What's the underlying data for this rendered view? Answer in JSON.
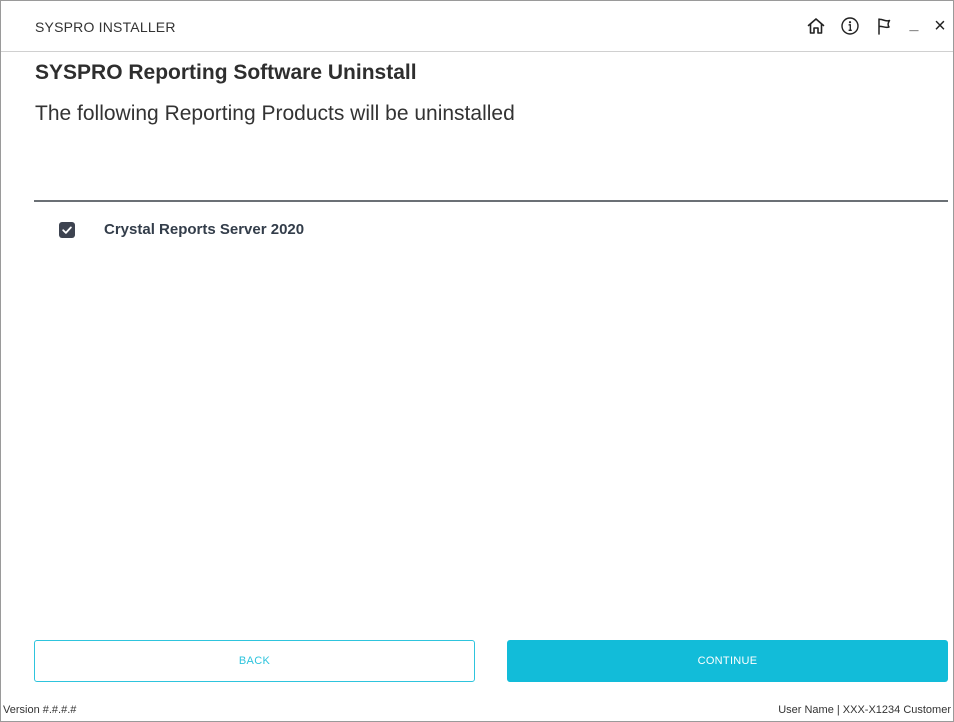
{
  "window": {
    "title": "SYSPRO INSTALLER",
    "controls": {
      "home_icon": "home-icon",
      "info_icon": "info-icon",
      "flag_icon": "flag-icon",
      "minimize_label": "_",
      "close_label": "×"
    }
  },
  "page": {
    "heading": "SYSPRO Reporting Software Uninstall",
    "subheading": "The following Reporting Products will be uninstalled"
  },
  "products": [
    {
      "label": "Crystal Reports Server 2020",
      "checked": true
    }
  ],
  "buttons": {
    "back_label": "BACK",
    "continue_label": "CONTINUE"
  },
  "footer": {
    "version": "Version #.#.#.#",
    "user": "User Name | XXX-X1234 Customer"
  },
  "colors": {
    "accent": "#12bcd9",
    "checkbox": "#3d4350"
  }
}
